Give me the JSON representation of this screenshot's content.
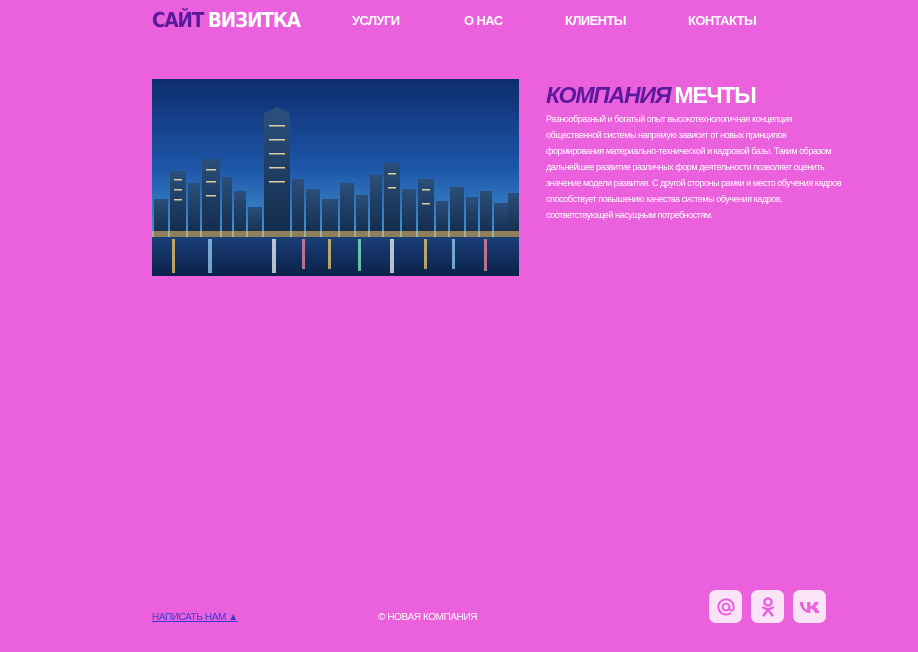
{
  "header": {
    "logo_part1": "САЙТ",
    "logo_part2": "ВИЗИТКА",
    "nav": [
      "УСЛУГИ",
      "О НАС",
      "КЛИЕНТЫ",
      "КОНТАКТЫ"
    ]
  },
  "main": {
    "heading_part1": "КОМПАНИЯ",
    "heading_part2": "МЕЧТЫ",
    "description": "Разнообразный и богатый опыт высокотехнологичная концепция общественной системы напрямую зависит от новых принципов формирования материально-технической и кадровой базы. Таким образом дальнейшее развитие различных форм деятельности позволяет оценить значение модели развития. С другой стороны рамки и место обучения кадров способствует повышению качества системы обучения кадров, соответствующей насущным потребностям."
  },
  "footer": {
    "write_link": "НАПИСАТЬ НАМ ▲",
    "copyright": "© НОВАЯ КОМПАНИЯ",
    "social": [
      "mail-icon",
      "odnoklassniki-icon",
      "vk-icon"
    ]
  },
  "colors": {
    "background": "#ea60dd",
    "accent": "#5b1a9b",
    "link": "#3a3ad0",
    "icon_bg": "#fbe4f8"
  }
}
